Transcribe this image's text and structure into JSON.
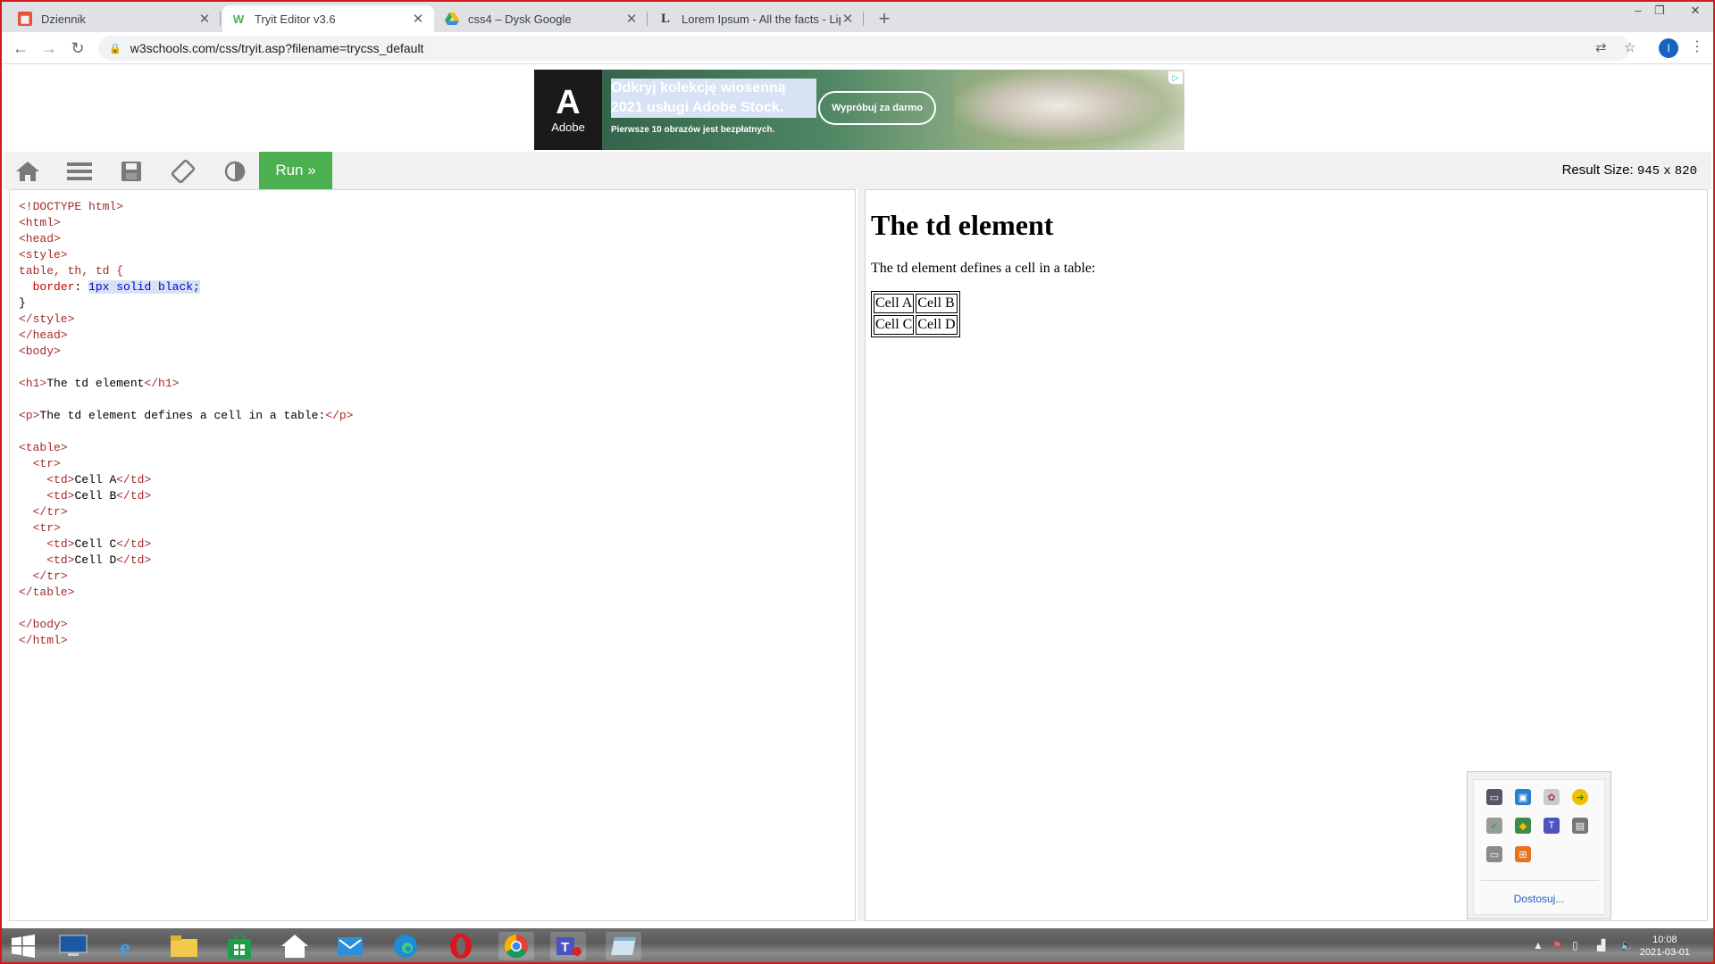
{
  "browser": {
    "tabs": [
      {
        "title": "Dziennik",
        "active": false
      },
      {
        "title": "Tryit Editor v3.6",
        "active": true
      },
      {
        "title": "css4 – Dysk Google",
        "active": false
      },
      {
        "title": "Lorem Ipsum - All the facts - Lips",
        "active": false
      }
    ],
    "url": "w3schools.com/css/tryit.asp?filename=trycss_default",
    "profile_initial": "I"
  },
  "ad": {
    "brand": "Adobe",
    "headline": "Odkryj kolekcję wiosenną 2021 usługi Adobe Stock.",
    "subline": "Pierwsze 10 obrazów jest bezpłatnych.",
    "cta": "Wypróbuj za darmo"
  },
  "editor": {
    "run_label": "Run »",
    "result_size_label": "Result Size:",
    "result_width": "945",
    "result_x": "x",
    "result_height": "820"
  },
  "code_lines": [
    "<!DOCTYPE html>",
    "<html>",
    "<head>",
    "<style>",
    "table, th, td {",
    "  border: 1px solid black;",
    "}",
    "</style>",
    "</head>",
    "<body>",
    "",
    "<h1>The td element</h1>",
    "",
    "<p>The td element defines a cell in a table:</p>",
    "",
    "<table>",
    "  <tr>",
    "    <td>Cell A</td>",
    "    <td>Cell B</td>",
    "  </tr>",
    "  <tr>",
    "    <td>Cell C</td>",
    "    <td>Cell D</td>",
    "  </tr>",
    "</table>",
    "",
    "</body>",
    "</html>"
  ],
  "result": {
    "heading": "The td element",
    "paragraph": "The td element defines a cell in a table:",
    "table": [
      [
        "Cell A",
        "Cell B"
      ],
      [
        "Cell C",
        "Cell D"
      ]
    ]
  },
  "tray": {
    "customize_link": "Dostosuj..."
  },
  "clock": {
    "time": "10:08",
    "date": "2021-03-01"
  },
  "colors": {
    "run_button": "#4caf50",
    "frame_border": "#d11a1a"
  }
}
